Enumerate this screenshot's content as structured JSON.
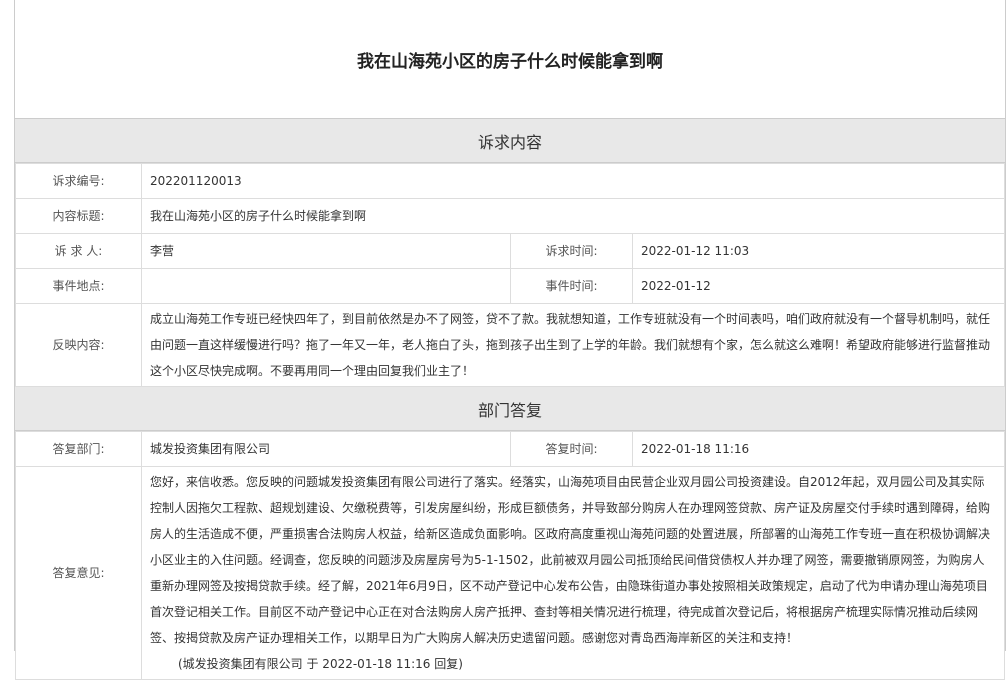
{
  "title": "我在山海苑小区的房子什么时候能拿到啊",
  "section1": "诉求内容",
  "fields": {
    "id_label": "诉求编号:",
    "id": "202201120013",
    "subject_label": "内容标题:",
    "subject": "我在山海苑小区的房子什么时候能拿到啊",
    "person_label": "诉 求 人:",
    "person": "李营",
    "time_label": "诉求时间:",
    "time": "2022-01-12 11:03",
    "place_label": "事件地点:",
    "place": "",
    "event_time_label": "事件时间:",
    "event_time": "2022-01-12",
    "content_label": "反映内容:",
    "content": "成立山海苑工作专班已经快四年了，到目前依然是办不了网签，贷不了款。我就想知道，工作专班就没有一个时间表吗，咱们政府就没有一个督导机制吗，就任由问题一直这样缓慢进行吗？拖了一年又一年，老人拖白了头，拖到孩子出生到了上学的年龄。我们就想有个家，怎么就这么难啊！希望政府能够进行监督推动这个小区尽快完成啊。不要再用同一个理由回复我们业主了！"
  },
  "section2": "部门答复",
  "reply": {
    "dept_label": "答复部门:",
    "dept": "城发投资集团有限公司",
    "time_label": "答复时间:",
    "time": "2022-01-18 11:16",
    "opinion_label": "答复意见:",
    "opinion": "您好，来信收悉。您反映的问题城发投资集团有限公司进行了落实。经落实，山海苑项目由民营企业双月园公司投资建设。自2012年起，双月园公司及其实际控制人因拖欠工程款、超规划建设、欠缴税费等，引发房屋纠纷，形成巨额债务，并导致部分购房人在办理网签贷款、房产证及房屋交付手续时遇到障碍，给购房人的生活造成不便，严重损害合法购房人权益，给新区造成负面影响。区政府高度重视山海苑问题的处置进展，所部署的山海苑工作专班一直在积极协调解决小区业主的入住问题。经调查，您反映的问题涉及房屋房号为5-1-1502，此前被双月园公司抵顶给民间借贷债权人并办理了网签，需要撤销原网签，为购房人重新办理网签及按揭贷款手续。经了解，2021年6月9日，区不动产登记中心发布公告，由隐珠街道办事处按照相关政策规定，启动了代为申请办理山海苑项目首次登记相关工作。目前区不动产登记中心正在对合法购房人房产抵押、查封等相关情况进行梳理，待完成首次登记后，将根据房产梳理实际情况推动后续网签、按揭贷款及房产证办理相关工作，以期早日为广大购房人解决历史遗留问题。感谢您对青岛西海岸新区的关注和支持！",
    "signature": "(城发投资集团有限公司 于 2022-01-18 11:16 回复)"
  }
}
